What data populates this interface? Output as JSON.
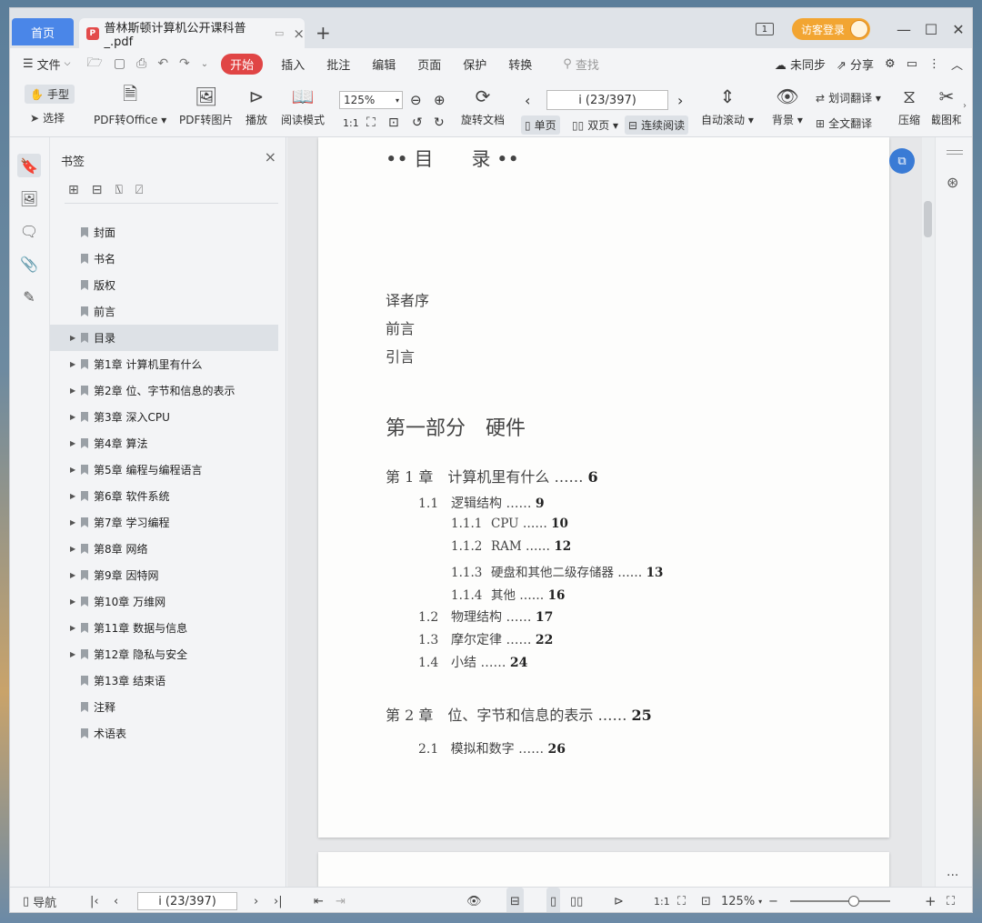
{
  "titlebar": {
    "home_tab": "首页",
    "doc_tab": "普林斯顿计算机公开课科普_.pdf",
    "page_badge": "1",
    "login": "访客登录"
  },
  "menu": {
    "file": "文件",
    "start": "开始",
    "items": [
      "插入",
      "批注",
      "编辑",
      "页面",
      "保护",
      "转换"
    ],
    "search": "查找",
    "sync": "未同步",
    "share": "分享"
  },
  "ribbon": {
    "hand": "手型",
    "select": "选择",
    "pdf_to_office": "PDF转Office",
    "pdf_to_image": "PDF转图片",
    "play": "播放",
    "read_mode": "阅读模式",
    "zoom": "125%",
    "rotate": "旋转文档",
    "page_indicator": "i (23/397)",
    "single": "单页",
    "double": "双页",
    "continuous": "连续阅读",
    "auto_scroll": "自动滚动",
    "background": "背景",
    "word_translate": "划词翻译",
    "full_translate": "全文翻译",
    "compress": "压缩",
    "screenshot": "截图和"
  },
  "bookmarks": {
    "title": "书签",
    "items": [
      {
        "label": "封面",
        "expandable": false
      },
      {
        "label": "书名",
        "expandable": false
      },
      {
        "label": "版权",
        "expandable": false
      },
      {
        "label": "前言",
        "expandable": false
      },
      {
        "label": "目录",
        "expandable": true,
        "selected": true
      },
      {
        "label": "第1章  计算机里有什么",
        "expandable": true
      },
      {
        "label": "第2章  位、字节和信息的表示",
        "expandable": true
      },
      {
        "label": "第3章  深入CPU",
        "expandable": true
      },
      {
        "label": "第4章  算法",
        "expandable": true
      },
      {
        "label": "第5章  编程与编程语言",
        "expandable": true
      },
      {
        "label": "第6章  软件系统",
        "expandable": true
      },
      {
        "label": "第7章  学习编程",
        "expandable": true
      },
      {
        "label": "第8章  网络",
        "expandable": true
      },
      {
        "label": "第9章  因特网",
        "expandable": true
      },
      {
        "label": "第10章  万维网",
        "expandable": true
      },
      {
        "label": "第11章  数据与信息",
        "expandable": true
      },
      {
        "label": "第12章  隐私与安全",
        "expandable": true
      },
      {
        "label": "第13章  结束语",
        "expandable": false
      },
      {
        "label": "注释",
        "expandable": false
      },
      {
        "label": "术语表",
        "expandable": false
      }
    ]
  },
  "document": {
    "toc_heading": "•• 目　　录 ••",
    "front": [
      "译者序",
      "前言",
      "引言"
    ],
    "part1": "第一部分　硬件",
    "ch1": {
      "title": "第 1 章　计算机里有什么 ……",
      "page": "6"
    },
    "sections": [
      {
        "num": "1.1",
        "title": "逻辑结构 ……",
        "page": "9",
        "level": 1
      },
      {
        "num": "1.1.1",
        "title": "CPU ……",
        "page": "10",
        "level": 2
      },
      {
        "num": "1.1.2",
        "title": "RAM ……",
        "page": "12",
        "level": 2
      },
      {
        "num": "1.1.3",
        "title": "硬盘和其他二级存储器 ……",
        "page": "13",
        "level": 2
      },
      {
        "num": "1.1.4",
        "title": "其他 ……",
        "page": "16",
        "level": 2
      },
      {
        "num": "1.2",
        "title": "物理结构 ……",
        "page": "17",
        "level": 1
      },
      {
        "num": "1.3",
        "title": "摩尔定律 ……",
        "page": "22",
        "level": 1
      },
      {
        "num": "1.4",
        "title": "小结 ……",
        "page": "24",
        "level": 1
      }
    ],
    "ch2": {
      "title": "第 2 章　位、字节和信息的表示 ……",
      "page": "25"
    },
    "ch2_sections": [
      {
        "num": "2.1",
        "title": "模拟和数字 ……",
        "page": "26"
      }
    ]
  },
  "statusbar": {
    "nav": "导航",
    "page_indicator": "i (23/397)",
    "zoom": "125%"
  },
  "colors": {
    "accent": "#4a86e8",
    "start_red": "#e04545",
    "login_orange": "#f2a532"
  }
}
